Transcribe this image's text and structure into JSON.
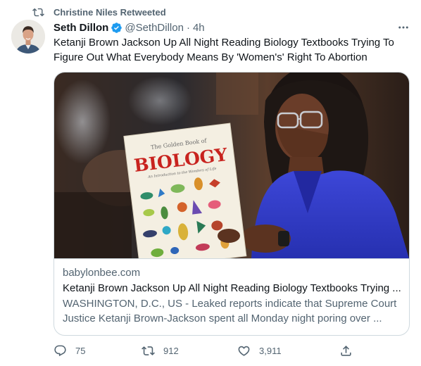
{
  "retweet": {
    "label": "Christine Niles Retweeted"
  },
  "author": {
    "name": "Seth Dillon",
    "handle": "@SethDillon",
    "separator": "·",
    "time": "4h"
  },
  "tweet": {
    "text": "Ketanji Brown Jackson Up All Night Reading Biology Textbooks Trying To Figure Out What Everybody Means By 'Women's' Right To Abortion"
  },
  "card": {
    "image": {
      "book_title_small": "The Golden Book of",
      "book_title": "BIOLOGY",
      "book_subtitle": "An Introduction to the Wonders of Life"
    },
    "domain": "babylonbee.com",
    "title": "Ketanji Brown Jackson Up All Night Reading Biology Textbooks Trying ...",
    "description": "WASHINGTON, D.C., US - Leaked reports indicate that Supreme Court Justice Ketanji Brown-Jackson spent all Monday night poring over ..."
  },
  "actions": {
    "replies": "75",
    "retweets": "912",
    "likes": "3,911"
  },
  "colors": {
    "text_primary": "#0f1419",
    "text_secondary": "#536471",
    "verified_blue": "#1d9bf0",
    "border": "#cfd9de"
  },
  "icons": {
    "retweet": "retweet-icon",
    "verified": "verified-badge-icon",
    "more": "more-icon",
    "reply": "reply-icon",
    "like": "heart-icon",
    "share": "share-icon"
  }
}
